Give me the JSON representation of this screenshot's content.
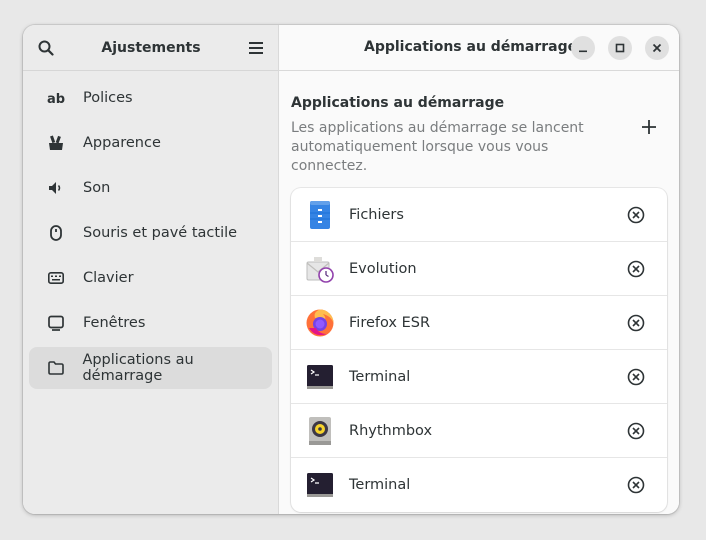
{
  "sidebar": {
    "title": "Ajustements",
    "items": [
      {
        "label": "Polices",
        "icon": "fonts-icon"
      },
      {
        "label": "Apparence",
        "icon": "appearance-icon"
      },
      {
        "label": "Son",
        "icon": "speaker-icon"
      },
      {
        "label": "Souris et pavé tactile",
        "icon": "mouse-icon"
      },
      {
        "label": "Clavier",
        "icon": "keyboard-icon"
      },
      {
        "label": "Fenêtres",
        "icon": "window-icon"
      },
      {
        "label": "Applications au démarrage",
        "icon": "folder-icon",
        "active": true
      }
    ]
  },
  "header": {
    "title": "Applications au démarrage"
  },
  "main": {
    "section_title": "Applications au démarrage",
    "section_description": "Les applications au démarrage se lancent automatiquement lorsque vous vous connectez.",
    "apps": [
      {
        "name": "Fichiers",
        "icon": "files-icon"
      },
      {
        "name": "Evolution",
        "icon": "evolution-icon"
      },
      {
        "name": "Firefox ESR",
        "icon": "firefox-icon"
      },
      {
        "name": "Terminal",
        "icon": "terminal-icon"
      },
      {
        "name": "Rhythmbox",
        "icon": "rhythmbox-icon"
      },
      {
        "name": "Terminal",
        "icon": "terminal-icon"
      }
    ]
  },
  "colors": {
    "accent_blue": "#3584e4",
    "sidebar_bg": "#ebebeb",
    "selected_bg": "#dcdcdc"
  }
}
